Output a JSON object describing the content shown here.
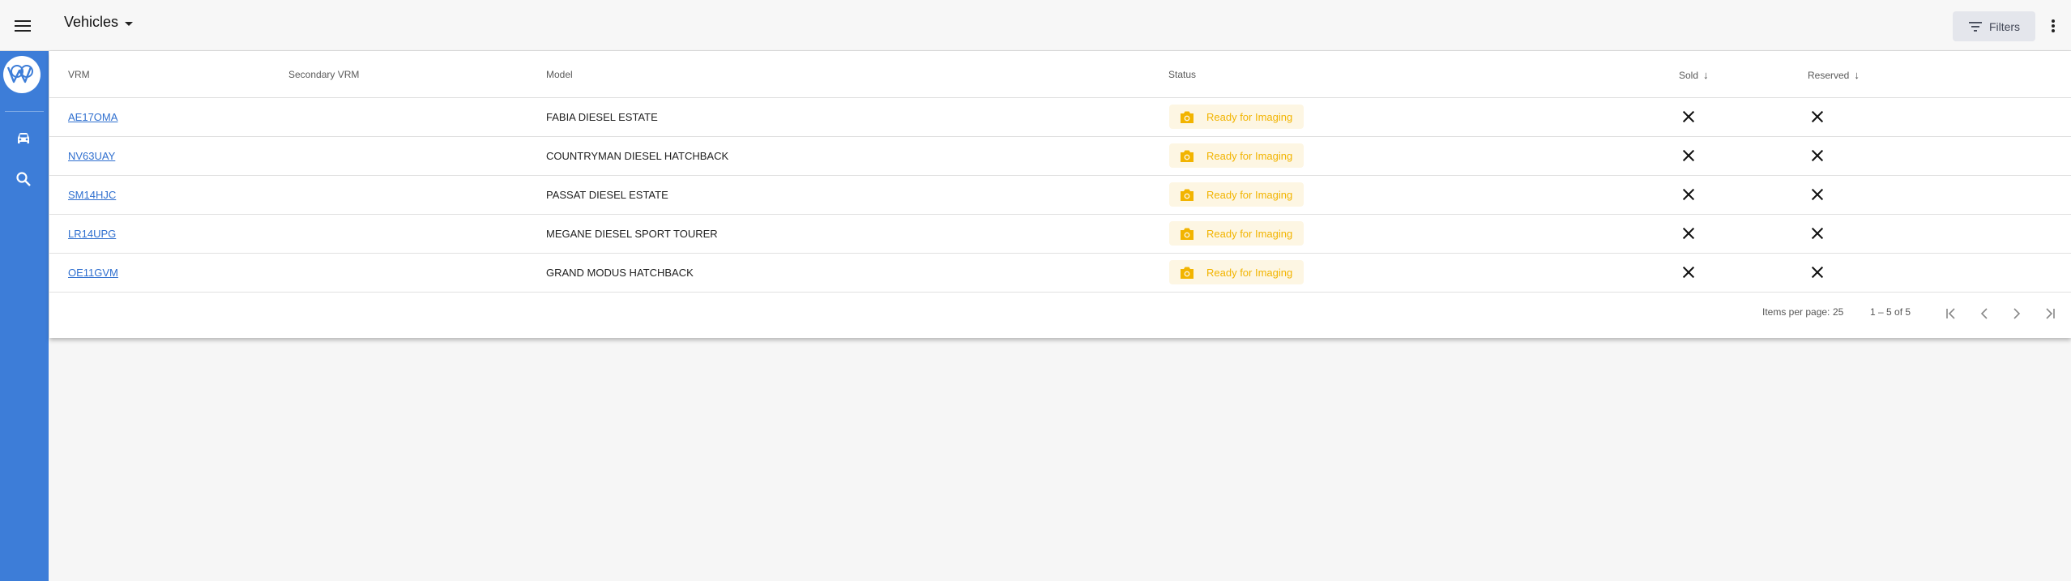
{
  "header": {
    "title": "Vehicles",
    "filters_label": "Filters"
  },
  "sidebar": {
    "items": [
      {
        "icon": "car-icon"
      },
      {
        "icon": "search-icon"
      }
    ]
  },
  "table": {
    "columns": {
      "vrm": "VRM",
      "secondary_vrm": "Secondary VRM",
      "model": "Model",
      "status": "Status",
      "sold": "Sold",
      "reserved": "Reserved"
    },
    "rows": [
      {
        "vrm": "AE17OMA",
        "secondary_vrm": "",
        "model": "FABIA DIESEL ESTATE",
        "status": "Ready for Imaging",
        "sold": false,
        "reserved": false
      },
      {
        "vrm": "NV63UAY",
        "secondary_vrm": "",
        "model": "COUNTRYMAN DIESEL HATCHBACK",
        "status": "Ready for Imaging",
        "sold": false,
        "reserved": false
      },
      {
        "vrm": "SM14HJC",
        "secondary_vrm": "",
        "model": "PASSAT DIESEL ESTATE",
        "status": "Ready for Imaging",
        "sold": false,
        "reserved": false
      },
      {
        "vrm": "LR14UPG",
        "secondary_vrm": "",
        "model": "MEGANE DIESEL SPORT TOURER",
        "status": "Ready for Imaging",
        "sold": false,
        "reserved": false
      },
      {
        "vrm": "OE11GVM",
        "secondary_vrm": "",
        "model": "GRAND MODUS HATCHBACK",
        "status": "Ready for Imaging",
        "sold": false,
        "reserved": false
      }
    ]
  },
  "paginator": {
    "items_per_page_label": "Items per page:",
    "items_per_page": "25",
    "range_label": "1 – 5 of 5"
  },
  "colors": {
    "sidebar": "#3d7dd8",
    "status_text": "#f2b400",
    "status_bg": "#fdf6e3",
    "link": "#2f6fcf"
  }
}
